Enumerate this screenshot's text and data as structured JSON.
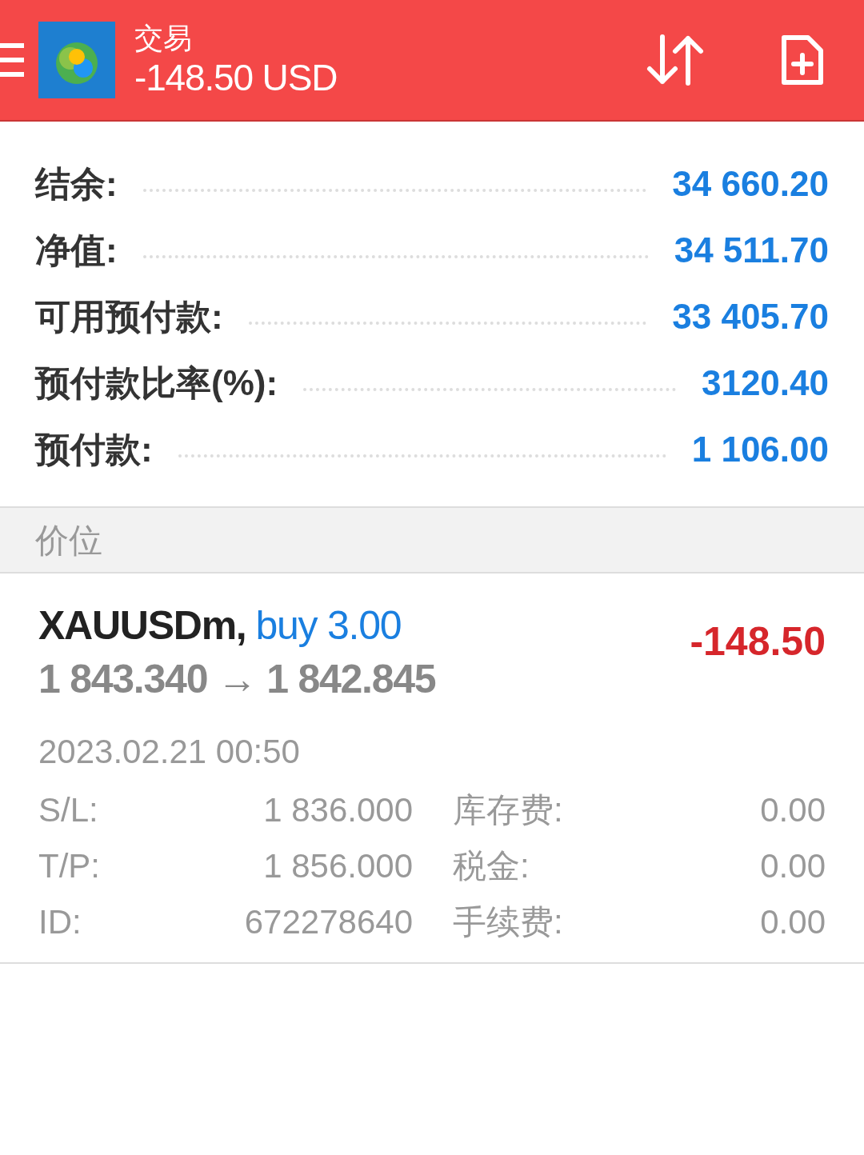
{
  "header": {
    "title": "交易",
    "profit": "-148.50 USD"
  },
  "account": [
    {
      "label": "结余:",
      "value": "34 660.20"
    },
    {
      "label": "净值:",
      "value": "34 511.70"
    },
    {
      "label": "可用预付款:",
      "value": "33 405.70"
    },
    {
      "label": "预付款比率(%):",
      "value": "3120.40"
    },
    {
      "label": "预付款:",
      "value": "1 106.00"
    }
  ],
  "section": {
    "title": "价位"
  },
  "positions": [
    {
      "symbol": "XAUUSDm,",
      "side": "buy 3.00",
      "prices": "1 843.340 → 1 842.845",
      "profit": "-148.50",
      "time": "2023.02.21 00:50",
      "details": [
        {
          "label": "S/L:",
          "value": "1 836.000",
          "label2": "库存费:",
          "value2": "0.00"
        },
        {
          "label": "T/P:",
          "value": "1 856.000",
          "label2": "税金:",
          "value2": "0.00"
        },
        {
          "label": "ID:",
          "value": "672278640",
          "label2": "手续费:",
          "value2": "0.00"
        }
      ]
    }
  ]
}
